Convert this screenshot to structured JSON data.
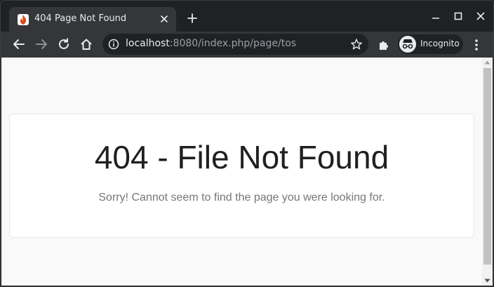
{
  "tab": {
    "title": "404 Page Not Found"
  },
  "address": {
    "host": "localhost",
    "path": ":8080/index.php/page/tos"
  },
  "profile": {
    "label": "Incognito"
  },
  "page": {
    "heading": "404 - File Not Found",
    "message": "Sorry! Cannot seem to find the page you were looking for."
  },
  "colors": {
    "tabstrip": "#202124",
    "toolbar": "#35363a",
    "page_bg": "#f9f9f9",
    "favicon_flame": "#dd4814"
  }
}
